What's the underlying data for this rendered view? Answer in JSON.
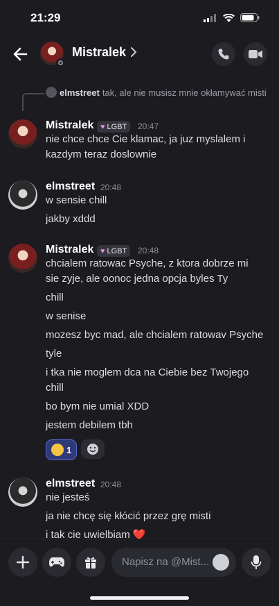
{
  "status_bar": {
    "time": "21:29"
  },
  "header": {
    "title": "Mistralek"
  },
  "reply": {
    "author": "elmstreet",
    "text": "tak, ale nie musisz mnie okłamywać misti"
  },
  "messages": [
    {
      "author": "Mistralek",
      "badge": "LGBT",
      "time": "20:47",
      "lines": [
        "nie chce chce Cie klamac, ja juz myslalem i",
        "kazdym teraz doslownie"
      ]
    },
    {
      "author": "elmstreet",
      "time": "20:48",
      "lines": [
        "w sensie chill",
        "jakby xddd"
      ]
    },
    {
      "author": "Mistralek",
      "badge": "LGBT",
      "time": "20:48",
      "lines": [
        "chcialem ratowac Psyche, z ktora dobrze mi",
        "sie zyje, ale oonoc jedna opcja byles Ty",
        "chill",
        "w senise",
        "mozesz byc mad, ale chcialem ratowav Psyche",
        "tyle",
        "i tka nie moglem dca na Ciebie bez Twojego",
        "chill",
        "bo bym nie umial XDD",
        "jestem debilem tbh"
      ],
      "reaction": {
        "emoji": "crying-face",
        "count": "1"
      }
    },
    {
      "author": "elmstreet",
      "time": "20:48",
      "lines": [
        "nie jesteś",
        "ja nie chcę się kłócić przez grę misti",
        "i tak cie uwielbiam ❤️"
      ]
    }
  ],
  "composer": {
    "placeholder": "Napisz na @Mist..."
  },
  "colors": {
    "background": "#1b1b20",
    "reaction_selected": "#2f3a78",
    "badge_heart": "#e58ed9"
  }
}
